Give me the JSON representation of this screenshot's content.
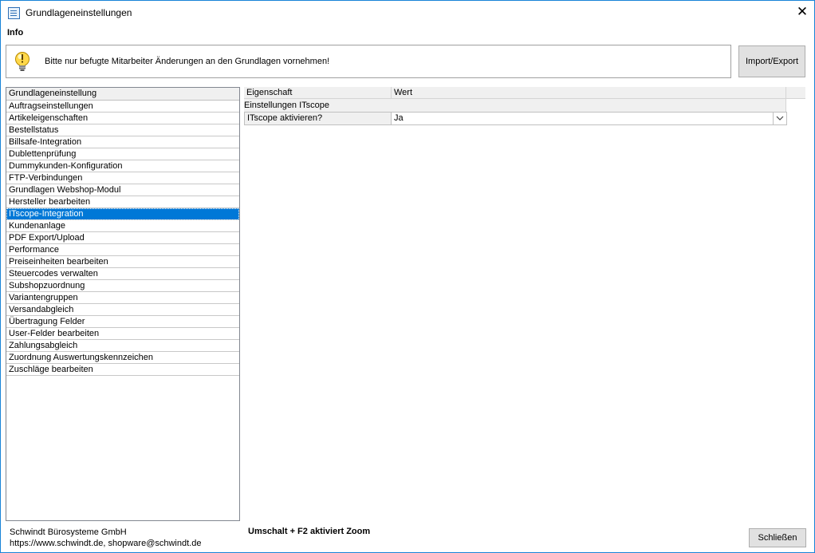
{
  "window": {
    "title": "Grundlageneinstellungen",
    "close_glyph": "✕"
  },
  "info": {
    "label": "Info",
    "message": "Bitte nur befugte Mitarbeiter Änderungen an den Grundlagen vornehmen!",
    "icon": "lightbulb-icon"
  },
  "buttons": {
    "import_export": "Import/Export",
    "close": "Schließen"
  },
  "settings_list": {
    "header": "Grundlageneinstellung",
    "items": [
      "Auftragseinstellungen",
      "Artikeleigenschaften",
      "Bestellstatus",
      "Billsafe-Integration",
      "Dublettenprüfung",
      "Dummykunden-Konfiguration",
      "FTP-Verbindungen",
      "Grundlagen Webshop-Modul",
      "Hersteller bearbeiten",
      "ITscope-Integration",
      "Kundenanlage",
      "PDF Export/Upload",
      "Performance",
      "Preiseinheiten bearbeiten",
      "Steuercodes verwalten",
      "Subshopzuordnung",
      "Variantengruppen",
      "Versandabgleich",
      "Übertragung Felder",
      "User-Felder bearbeiten",
      "Zahlungsabgleich",
      "Zuordnung Auswertungskennzeichen",
      "Zuschläge bearbeiten"
    ],
    "selected_index": 9
  },
  "property_grid": {
    "col_property": "Eigenschaft",
    "col_value": "Wert",
    "category": "Einstellungen ITscope",
    "rows": [
      {
        "property": "ITscope aktivieren?",
        "value": "Ja"
      }
    ]
  },
  "footer": {
    "company_line1": "Schwindt Bürosysteme GmbH",
    "company_line2": "https://www.schwindt.de, shopware@schwindt.de",
    "zoom_hint": "Umschalt + F2 aktiviert Zoom"
  },
  "colors": {
    "selection": "#0078d7",
    "window_border": "#1883d7",
    "button_face": "#e1e1e1"
  }
}
